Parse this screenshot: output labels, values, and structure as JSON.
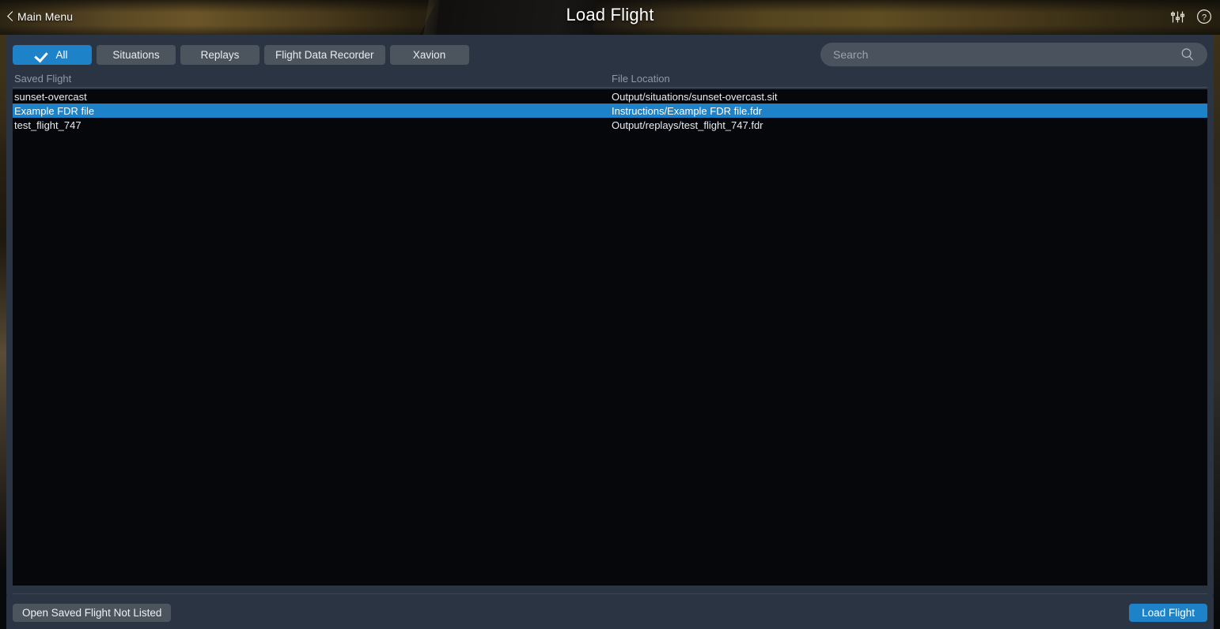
{
  "header": {
    "back_label": "Main Menu",
    "title": "Load Flight",
    "settings_icon": "sliders-icon",
    "help_icon": "question-circle-icon"
  },
  "tabs": [
    {
      "label": "All",
      "selected": true,
      "icon": "check-icon"
    },
    {
      "label": "Situations",
      "selected": false
    },
    {
      "label": "Replays",
      "selected": false
    },
    {
      "label": "Flight Data Recorder",
      "selected": false
    },
    {
      "label": "Xavion",
      "selected": false
    }
  ],
  "search": {
    "placeholder": "Search",
    "value": "",
    "icon": "search-icon"
  },
  "list": {
    "columns": [
      "Saved Flight",
      "File Location"
    ],
    "rows": [
      {
        "name": "sunset-overcast",
        "location": "Output/situations/sunset-overcast.sit",
        "selected": false
      },
      {
        "name": "Example FDR file",
        "location": "Instructions/Example FDR file.fdr",
        "selected": true
      },
      {
        "name": "test_flight_747",
        "location": "Output/replays/test_flight_747.fdr",
        "selected": false
      }
    ]
  },
  "footer": {
    "open_not_listed_label": "Open Saved Flight Not Listed",
    "load_flight_label": "Load Flight"
  },
  "colors": {
    "accent": "#1e82c8",
    "panel": "#2a3442",
    "list_background": "#05070b",
    "button": "#4c545e",
    "muted_text": "#8e99a5"
  }
}
